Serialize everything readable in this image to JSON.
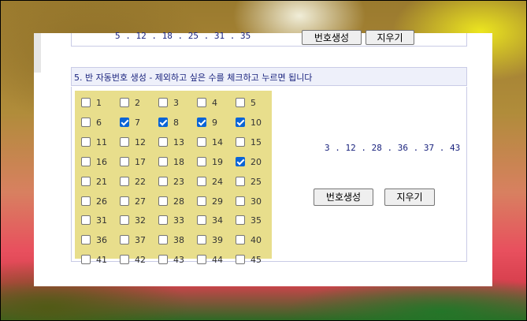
{
  "previous_section": {
    "numbers": "5 . 12 . 18 . 25 . 31 . 35",
    "generate_label": "번호생성",
    "clear_label": "지우기"
  },
  "section5": {
    "title": "5. 반 자동번호 생성 - 제외하고 싶은 수를 체크하고 누르면 됩니다",
    "numbers": [
      {
        "label": "1",
        "checked": false
      },
      {
        "label": "2",
        "checked": false
      },
      {
        "label": "3",
        "checked": false
      },
      {
        "label": "4",
        "checked": false
      },
      {
        "label": "5",
        "checked": false
      },
      {
        "label": "6",
        "checked": false
      },
      {
        "label": "7",
        "checked": true
      },
      {
        "label": "8",
        "checked": true
      },
      {
        "label": "9",
        "checked": true
      },
      {
        "label": "10",
        "checked": true
      },
      {
        "label": "11",
        "checked": false
      },
      {
        "label": "12",
        "checked": false
      },
      {
        "label": "13",
        "checked": false
      },
      {
        "label": "14",
        "checked": false
      },
      {
        "label": "15",
        "checked": false
      },
      {
        "label": "16",
        "checked": false
      },
      {
        "label": "17",
        "checked": false
      },
      {
        "label": "18",
        "checked": false
      },
      {
        "label": "19",
        "checked": false
      },
      {
        "label": "20",
        "checked": true
      },
      {
        "label": "21",
        "checked": false
      },
      {
        "label": "22",
        "checked": false
      },
      {
        "label": "23",
        "checked": false
      },
      {
        "label": "24",
        "checked": false
      },
      {
        "label": "25",
        "checked": false
      },
      {
        "label": "26",
        "checked": false
      },
      {
        "label": "27",
        "checked": false
      },
      {
        "label": "28",
        "checked": false
      },
      {
        "label": "29",
        "checked": false
      },
      {
        "label": "30",
        "checked": false
      },
      {
        "label": "31",
        "checked": false
      },
      {
        "label": "32",
        "checked": false
      },
      {
        "label": "33",
        "checked": false
      },
      {
        "label": "34",
        "checked": false
      },
      {
        "label": "35",
        "checked": false
      },
      {
        "label": "36",
        "checked": false
      },
      {
        "label": "37",
        "checked": false
      },
      {
        "label": "38",
        "checked": false
      },
      {
        "label": "39",
        "checked": false
      },
      {
        "label": "40",
        "checked": false
      },
      {
        "label": "41",
        "checked": false
      },
      {
        "label": "42",
        "checked": false
      },
      {
        "label": "43",
        "checked": false
      },
      {
        "label": "44",
        "checked": false
      },
      {
        "label": "45",
        "checked": false
      }
    ],
    "result": "3 . 12 . 28 . 36 . 37 . 43",
    "generate_label": "번호생성",
    "clear_label": "지우기"
  }
}
